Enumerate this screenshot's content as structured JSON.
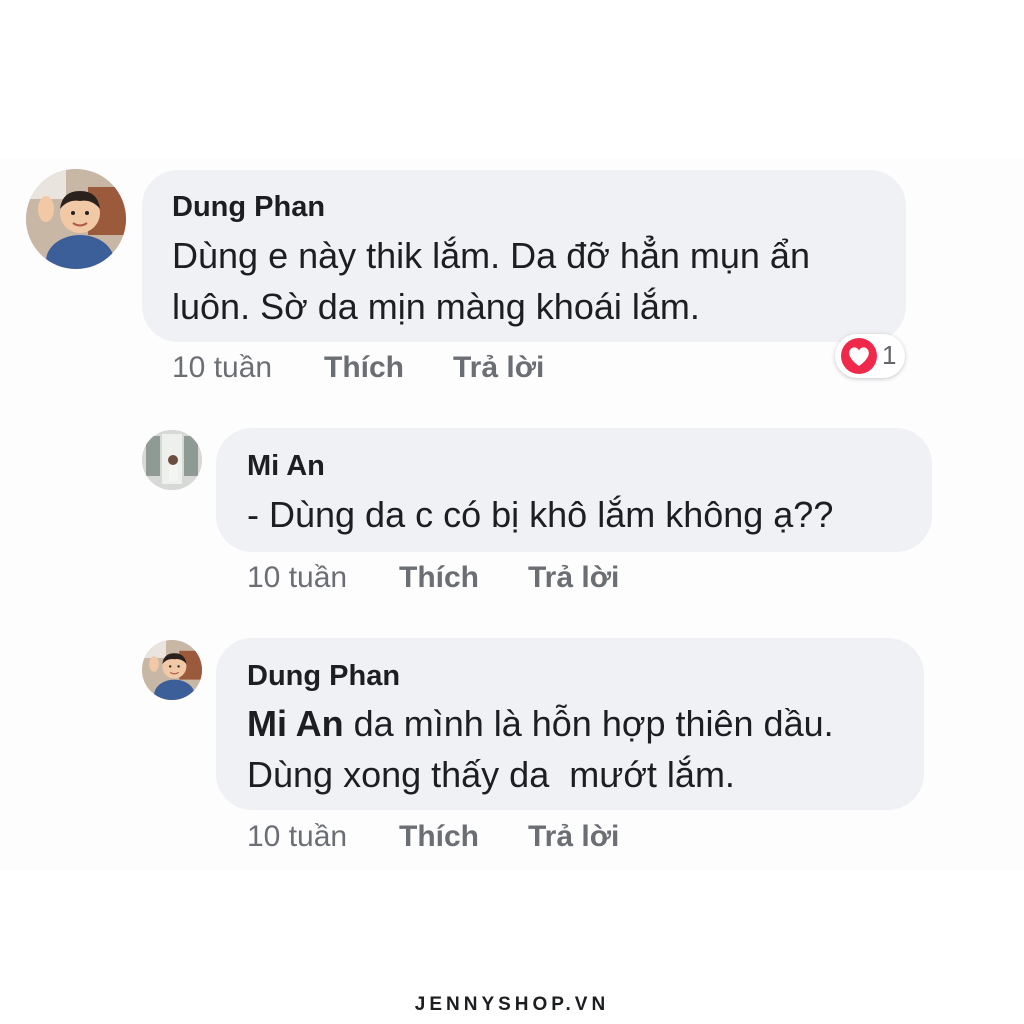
{
  "comments": [
    {
      "author": "Dung Phan",
      "lines": [
        "Dùng e này thik lắm. Da đỡ hẳn mụn ẩn",
        "luôn. Sờ da mịn màng khoái lắm."
      ],
      "time": "10 tuần",
      "like_label": "Thích",
      "reply_label": "Trả lời",
      "reaction": {
        "icon": "heart-icon",
        "count": "1",
        "color": "#f0284a"
      }
    },
    {
      "author": "Mi An",
      "lines": [
        "- Dùng da c có bị khô lắm không ạ??"
      ],
      "time": "10 tuần",
      "like_label": "Thích",
      "reply_label": "Trả lời"
    },
    {
      "author": "Dung Phan",
      "mention": "Mi An",
      "lines": [
        " da mình là hỗn hợp thiên dầu.",
        "Dùng xong thấy da  mướt lắm."
      ],
      "time": "10 tuần",
      "like_label": "Thích",
      "reply_label": "Trả lời"
    }
  ],
  "watermark": "JENNYSHOP.VN",
  "colors": {
    "bubble": "#f0f1f5",
    "text": "#1c1e21",
    "meta": "#6b6e73",
    "reaction": "#f0284a"
  }
}
